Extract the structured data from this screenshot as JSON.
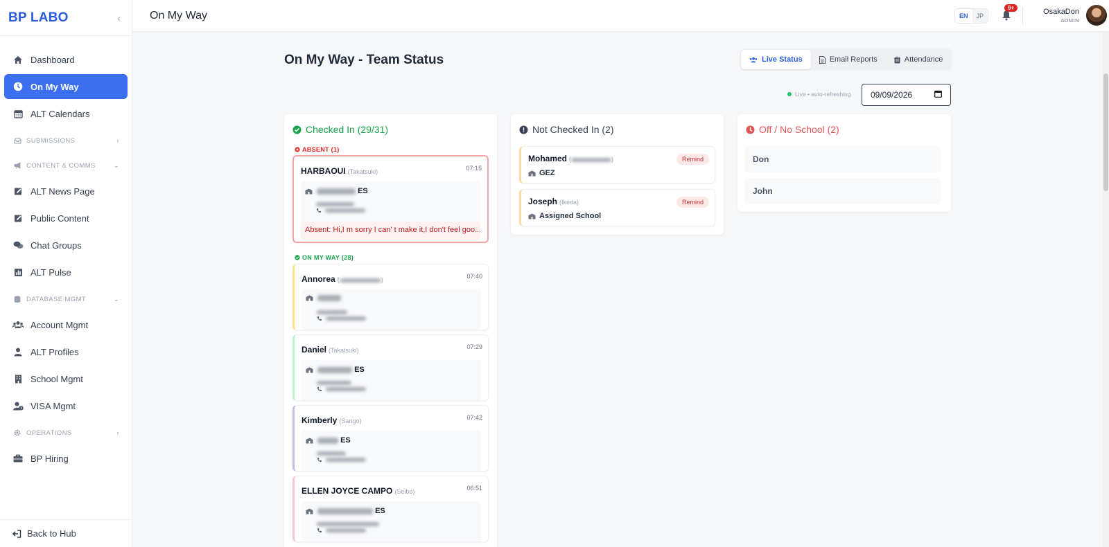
{
  "brand": "BP LABO",
  "nav": {
    "dashboard": "Dashboard",
    "on_my_way": "On My Way",
    "alt_calendars": "ALT Calendars",
    "submissions": "SUBMISSIONS",
    "content_comms": "CONTENT & COMMS",
    "alt_news": "ALT News Page",
    "public_content": "Public Content",
    "chat_groups": "Chat Groups",
    "alt_pulse": "ALT Pulse",
    "database_mgmt": "DATABASE MGMT",
    "account_mgmt": "Account Mgmt",
    "alt_profiles": "ALT Profiles",
    "school_mgmt": "School Mgmt",
    "visa_mgmt": "VISA Mgmt",
    "operations": "OPERATIONS",
    "bp_hiring": "BP Hiring",
    "back_to_hub": "Back to Hub"
  },
  "topbar": {
    "title": "On My Way",
    "lang_en": "EN",
    "lang_jp": "JP",
    "notif_badge": "9+",
    "user_name": "OsakaDon",
    "user_role": "ADMIN"
  },
  "main": {
    "title": "On My Way - Team Status",
    "tabs": [
      "Live Status",
      "Email Reports",
      "Attendance"
    ],
    "live_text": "Live • auto-refreshing",
    "date": "09/09/2026"
  },
  "checked_in": {
    "heading": "Checked In (29/31)",
    "absent_label": "ABSENT (1)",
    "on_my_way_label": "ON MY WAY (28)",
    "absent_card": {
      "name": "HARBAOUI",
      "area": "(Takatsuki)",
      "time": "07:15",
      "school_suffix": "ES",
      "message": "Absent: Hi,I m sorry I can' t make it,I don't feel goo..."
    },
    "cards": [
      {
        "name": "Annorea",
        "area": "",
        "time": "07:40",
        "school_suffix": "",
        "accent": "#fde68a"
      },
      {
        "name": "Daniel",
        "area": "(Takatsuki)",
        "time": "07:29",
        "school_suffix": "ES",
        "accent": "#bbf7d0"
      },
      {
        "name": "Kimberly",
        "area": "(Sango)",
        "time": "07:42",
        "school_suffix": "ES",
        "accent": "#c7b8e8"
      },
      {
        "name": "ELLEN JOYCE CAMPO",
        "area": "(Seibo)",
        "time": "06:51",
        "school_suffix": "ES",
        "accent": "#f9c4d8"
      }
    ]
  },
  "not_checked_in": {
    "heading": "Not Checked In (2)",
    "remind_label": "Remind",
    "cards": [
      {
        "name": "Mohamed",
        "area": "",
        "school": "GEZ"
      },
      {
        "name": "Joseph",
        "area": "(Ikeda)",
        "school": "Assigned School"
      }
    ]
  },
  "off": {
    "heading": "Off / No School (2)",
    "people": [
      "Don",
      "John"
    ]
  },
  "colors": {
    "brand": "#2b5cdc",
    "active_nav": "#3b6ff0",
    "checked_green": "#16a34a",
    "absent_red": "#dc2626",
    "off_red": "#e05656"
  }
}
